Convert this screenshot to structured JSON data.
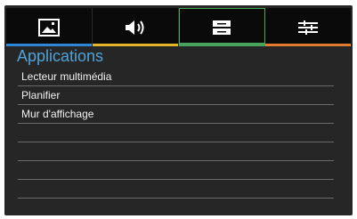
{
  "tabs": [
    {
      "icon": "image-icon",
      "accent": "#2e86d6"
    },
    {
      "icon": "speaker-icon",
      "accent": "#e2b52b"
    },
    {
      "icon": "storage-icon",
      "accent": "#47a55b",
      "selected": true
    },
    {
      "icon": "sliders-icon",
      "accent": "#e07b2f"
    }
  ],
  "section": {
    "title": "Applications",
    "title_color": "#4fa3d8"
  },
  "items": [
    {
      "label": "Lecteur multimédia"
    },
    {
      "label": "Planifier"
    },
    {
      "label": "Mur d'affichage"
    },
    {
      "label": ""
    },
    {
      "label": ""
    },
    {
      "label": ""
    },
    {
      "label": ""
    },
    {
      "label": ""
    }
  ]
}
